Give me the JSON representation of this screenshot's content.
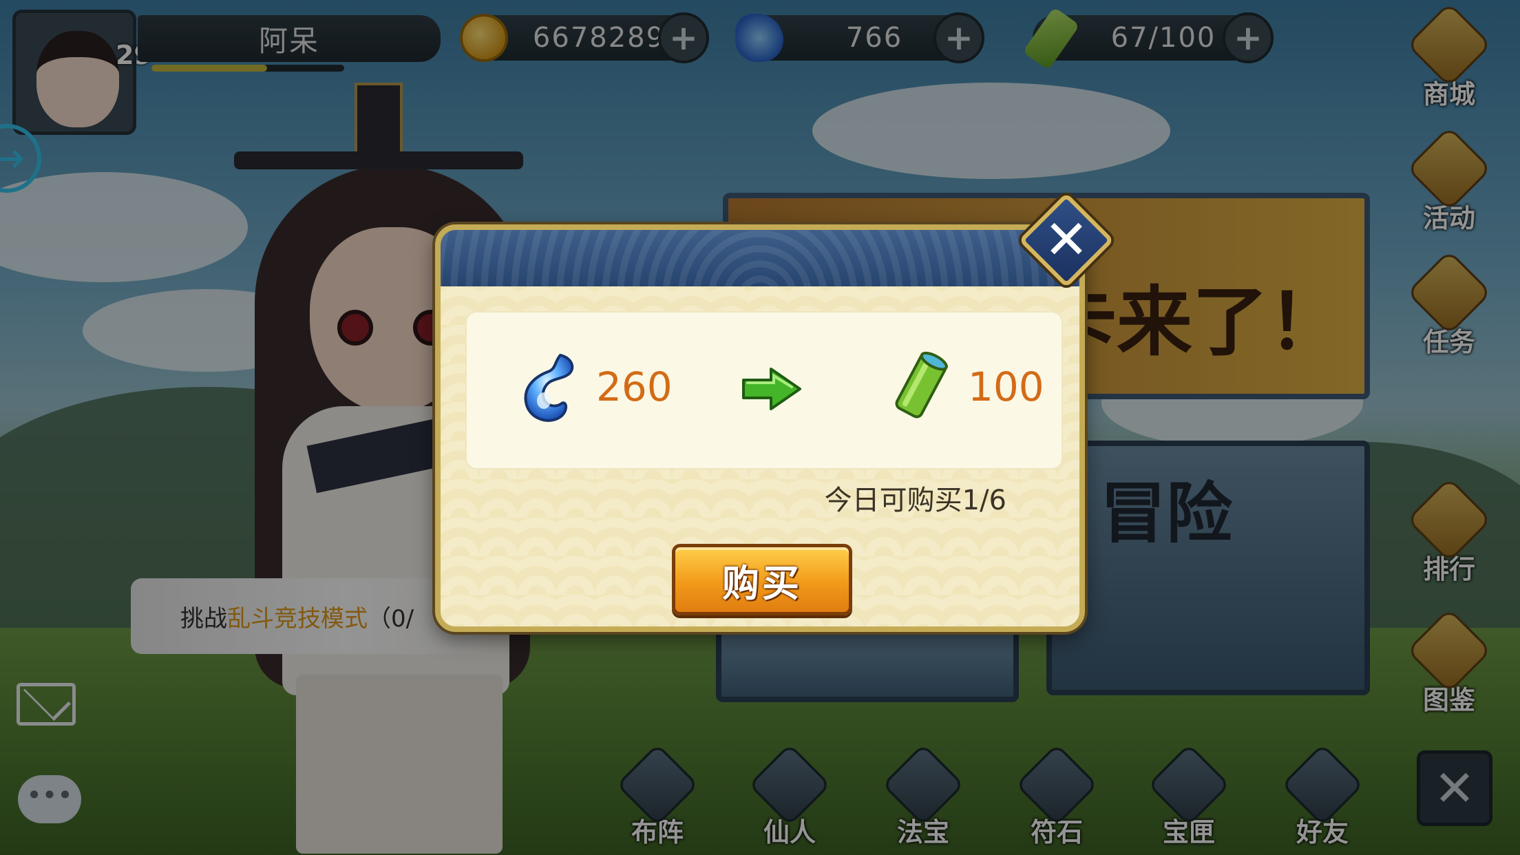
{
  "player": {
    "name": "阿呆",
    "level": "29",
    "xp_progress": 0.6
  },
  "resources": {
    "coins": "6678289",
    "jade": "766",
    "stamina": "67/100"
  },
  "side_menu": [
    "商城",
    "活动",
    "任务",
    "排行",
    "图鉴"
  ],
  "bottom_nav": [
    "布阵",
    "仙人",
    "法宝",
    "符石",
    "宝匣",
    "好友"
  ],
  "background": {
    "event_banner": "月卡来了！",
    "adventure": "冒险",
    "quest_prefix": "挑战",
    "quest_highlight": "乱斗竞技模式",
    "quest_suffix": "（0/"
  },
  "modal": {
    "cost_value": "260",
    "gain_value": "100",
    "limit_text": "今日可购买1/6",
    "buy_label": "购买"
  },
  "colors": {
    "accent_orange": "#f29a1a",
    "value_orange": "#d36b16",
    "header_blue": "#26446e",
    "frame_gold": "#c4ab56",
    "arrow_green": "#44b428"
  },
  "icons": {
    "coin": "coin-icon",
    "jade": "jade-icon",
    "stamina": "bamboo-scroll-icon",
    "arrow": "green-arrow-icon",
    "close": "close-icon"
  }
}
